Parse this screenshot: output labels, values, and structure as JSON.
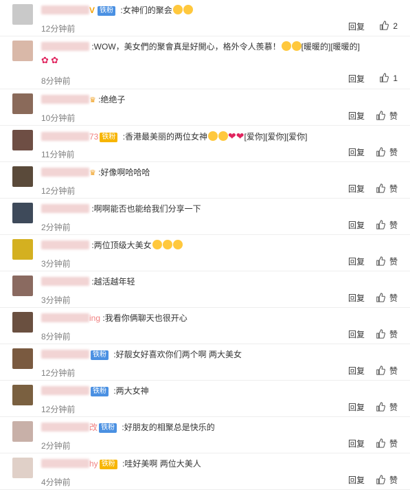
{
  "colors": {
    "accent_blue": "#4a90e2",
    "badge_gold": "#f7b500",
    "time": "#808080"
  },
  "actions": {
    "reply_label": "回复",
    "like_label": "赞"
  },
  "comments": [
    {
      "prefix": "",
      "badge": "铁粉",
      "badge_type": "V",
      "text": "女神们的聚会",
      "time": "12分钟前",
      "likes": "2",
      "emoji_count": 2,
      "avatar": "#c9c9c9"
    },
    {
      "prefix": "",
      "badge": "",
      "text": "WOW，美女們的聚會真是好開心，格外令人羨慕！",
      "suffix": "[暖暖的][暖暖的]",
      "time": "8分钟前",
      "likes": "1",
      "emoji_count": 2,
      "avatar": "#d9b8a8",
      "tall": true
    },
    {
      "prefix": "",
      "badge": "",
      "text": "绝绝子",
      "time": "10分钟前",
      "likes": "",
      "avatar": "#8a6a5a",
      "crown": true
    },
    {
      "prefix": "73",
      "badge": "铁粉",
      "badge_type": "gold",
      "text": "香港最美丽的两位女神",
      "suffix": "[爱你][爱你][爱你]",
      "time": "11分钟前",
      "likes": "",
      "avatar": "#6e4e44",
      "hearts": 2,
      "emoji_count": 2
    },
    {
      "prefix": "",
      "badge": "",
      "text": "好像啊哈哈哈",
      "time": "12分钟前",
      "likes": "",
      "avatar": "#5a4a3a",
      "crown": true
    },
    {
      "prefix": "",
      "badge": "",
      "text": "啊啊能否也能给我们分享一下",
      "time": "2分钟前",
      "likes": "",
      "avatar": "#3e4a5a"
    },
    {
      "prefix": "",
      "badge": "",
      "text": "两位顶级大美女",
      "time": "3分钟前",
      "likes": "",
      "avatar": "#d4b020",
      "emoji_count": 3
    },
    {
      "prefix": "",
      "badge": "",
      "text": "越活越年轻",
      "time": "3分钟前",
      "likes": "",
      "avatar": "#8a6a60"
    },
    {
      "prefix": "ing",
      "badge": "",
      "text": "我看你俩聊天也很开心",
      "time": "8分钟前",
      "likes": "",
      "avatar": "#6a5040"
    },
    {
      "prefix": "",
      "badge": "铁粉",
      "badge_type": "blue",
      "text": "好靓女好喜欢你们两个啊 两大美女",
      "time": "12分钟前",
      "likes": "",
      "avatar": "#7a5a40"
    },
    {
      "prefix": "",
      "badge": "铁粉",
      "badge_type": "blue",
      "text": "两大女神",
      "time": "12分钟前",
      "likes": "",
      "avatar": "#7a6040"
    },
    {
      "prefix": "改",
      "badge": "铁粉",
      "badge_type": "blue",
      "text": "好朋友的相聚总是快乐的",
      "time": "2分钟前",
      "likes": "",
      "avatar": "#c8b0a8"
    },
    {
      "prefix": "hy",
      "badge": "铁粉",
      "badge_type": "gold",
      "text": "哇好美啊 两位大美人",
      "time": "4分钟前",
      "likes": "",
      "avatar": "#e0d0c8"
    }
  ]
}
